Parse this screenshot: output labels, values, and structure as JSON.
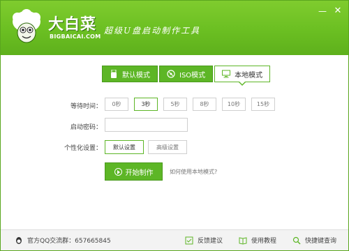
{
  "app": {
    "title": "大白菜",
    "url": "BIGBAICAI.COM",
    "slogan": "超级U盘启动制作工具",
    "brand_color": "#6bbf22"
  },
  "window_controls": {
    "minimize": "—",
    "close": "✕"
  },
  "tabs": [
    {
      "label": "默认模式",
      "icon": "usb-icon",
      "active": false
    },
    {
      "label": "ISO模式",
      "icon": "disc-icon",
      "active": false
    },
    {
      "label": "本地模式",
      "icon": "monitor-icon",
      "active": true
    }
  ],
  "form": {
    "wait_label": "等待时间：",
    "wait_options": [
      "0秒",
      "3秒",
      "5秒",
      "8秒",
      "10秒",
      "15秒"
    ],
    "wait_selected": "3秒",
    "password_label": "启动密码：",
    "password_value": "",
    "personal_label": "个性化设置：",
    "personal_options": [
      "默认设置",
      "高级设置"
    ],
    "personal_selected": "默认设置"
  },
  "actions": {
    "start_label": "开始制作",
    "howto_link": "如何使用本地模式?"
  },
  "footer": {
    "qq_label": "官方QQ交流群：657665845",
    "feedback_label": "反馈建议",
    "tutorial_label": "使用教程",
    "fast_label": "快捷键查询"
  }
}
